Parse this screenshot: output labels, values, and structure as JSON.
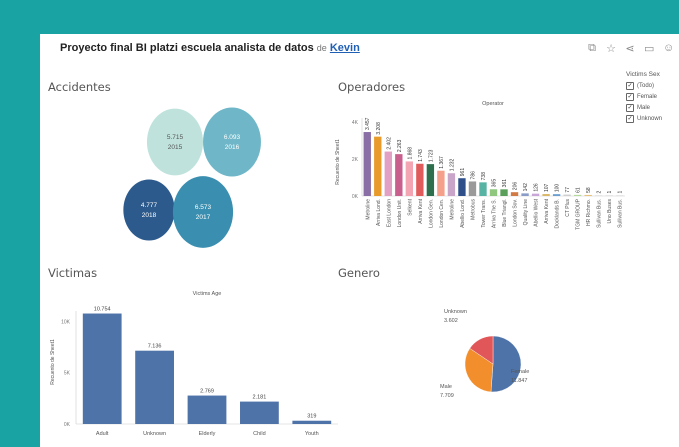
{
  "header": {
    "title": "Proyecto final BI platzi escuela analista de datos",
    "by": "de",
    "author": "Kevin",
    "icons": [
      "pages-icon",
      "star-icon",
      "share-icon",
      "comment-icon",
      "user-icon"
    ]
  },
  "sections": {
    "accidentes": "Accidentes",
    "operadores": "Operadores",
    "victimas": "Victimas",
    "genero": "Genero"
  },
  "legend": {
    "title": "Victims Sex",
    "items": [
      "(Todo)",
      "Female",
      "Male",
      "Unknown"
    ]
  },
  "chart_data": [
    {
      "type": "bubble",
      "name": "Accidentes",
      "points": [
        {
          "year": "2015",
          "value": 5715,
          "label": "5.715",
          "color": "#bfe3dc"
        },
        {
          "year": "2016",
          "value": 6093,
          "label": "6.093",
          "color": "#6fb7c8"
        },
        {
          "year": "2018",
          "value": 4777,
          "label": "4.777",
          "color": "#2c5a8d"
        },
        {
          "year": "2017",
          "value": 6573,
          "label": "6.573",
          "color": "#3a8fb0"
        }
      ]
    },
    {
      "type": "bar",
      "name": "Operadores",
      "title": "Operator",
      "ylabel": "Recuento de Sheet1",
      "yticks": [
        "0K",
        "2K",
        "4K"
      ],
      "ylim": [
        0,
        4000
      ],
      "categories": [
        "Metroline",
        "Arriva Lond.",
        "East London",
        "London Unit.",
        "Selkent",
        "Arriva Kent",
        "London Gen.",
        "London Cen.",
        "Metroline",
        "Abellio Lond.",
        "Metrobus",
        "Tower Trans.",
        "Arriva The S.",
        "Blue Triangl.",
        "London Sov.",
        "Quality Line",
        "Abellio West",
        "Arriva Kent",
        "Docklands B.",
        "CT Plus",
        "TGM GROUP",
        "HR Richmo.",
        "Sullivan Bus.",
        "Uno Buses",
        "Sullivan Bus."
      ],
      "values": [
        3457,
        3208,
        2402,
        2263,
        1868,
        1743,
        1723,
        1367,
        1232,
        961,
        786,
        738,
        365,
        361,
        206,
        142,
        126,
        107,
        100,
        77,
        61,
        58,
        2,
        1,
        1
      ],
      "labels": [
        "3.457",
        "3.208",
        "2.402",
        "2.263",
        "1.868",
        "1.743",
        "1.723",
        "1.367",
        "1.232",
        "961",
        "786",
        "738",
        "365",
        "361",
        "206",
        "142",
        "126",
        "107",
        "100",
        "77",
        "61",
        "58",
        "2",
        "1",
        "1"
      ],
      "colors": [
        "#8a6ea6",
        "#e89a2a",
        "#e2a0c4",
        "#c85f8c",
        "#f3a5b3",
        "#e05c5c",
        "#2e6f4e",
        "#f5a08a",
        "#c9a6c9",
        "#2e4f8a",
        "#9a9a9a",
        "#57b3a3",
        "#8fc77f",
        "#5aa05a",
        "#d17a45",
        "#8a9cc8",
        "#c8a6d8",
        "#d9b86a",
        "#6a9fcf",
        "#cfcfcf",
        "#b5d99c",
        "#e7c27a",
        "#cccccc",
        "#cccccc",
        "#cccccc"
      ]
    },
    {
      "type": "bar",
      "name": "Victimas",
      "title": "Victims Age",
      "ylabel": "Recuento de Sheet1",
      "yticks": [
        "0K",
        "5K",
        "10K"
      ],
      "ylim": [
        0,
        11000
      ],
      "categories": [
        "Adult",
        "Unknown",
        "Elderly",
        "Child",
        "Youth"
      ],
      "values": [
        10754,
        7136,
        2769,
        2181,
        319
      ],
      "labels": [
        "10.754",
        "7.136",
        "2.769",
        "2.181",
        "319"
      ],
      "color": "#4e73a8"
    },
    {
      "type": "pie",
      "name": "Genero",
      "slices": [
        {
          "name": "Female",
          "value": 11847,
          "label": "11.847",
          "color": "#4e73a8"
        },
        {
          "name": "Male",
          "value": 7709,
          "label": "7.709",
          "color": "#f28e2b"
        },
        {
          "name": "Unknown",
          "value": 3602,
          "label": "3.602",
          "color": "#e15759"
        }
      ]
    }
  ]
}
